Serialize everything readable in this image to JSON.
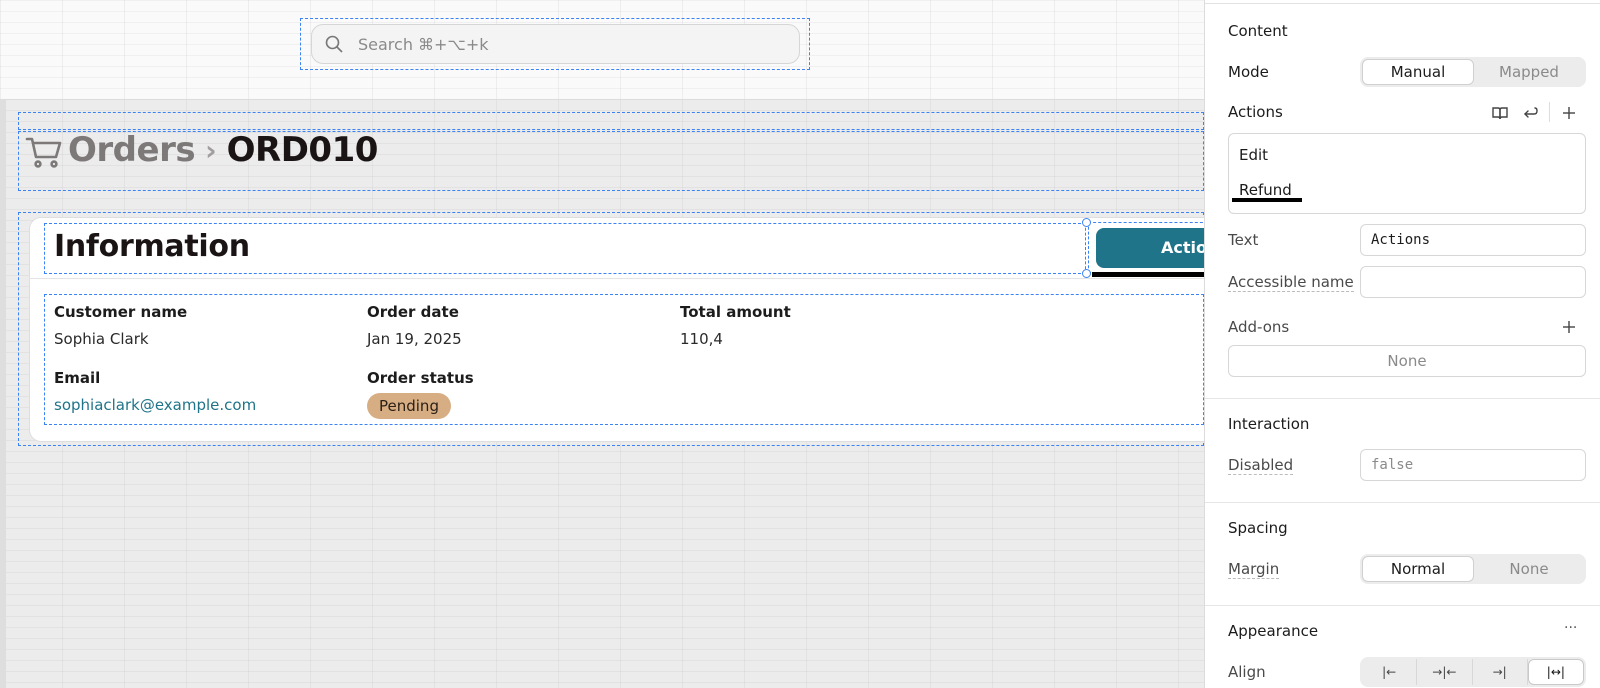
{
  "canvas": {
    "search": {
      "placeholder": "Search ⌘+⌥+k",
      "icon": "search-icon"
    },
    "breadcrumb": {
      "icon": "cart-icon",
      "parent": "Orders",
      "separator": "›",
      "current": "ORD010"
    },
    "info_card": {
      "title": "Information",
      "actions_button_label": "Actions",
      "fields": {
        "customer_name": {
          "label": "Customer name",
          "value": "Sophia Clark"
        },
        "order_date": {
          "label": "Order date",
          "value": "Jan 19, 2025"
        },
        "total_amount": {
          "label": "Total amount",
          "value": "110,4"
        },
        "email": {
          "label": "Email",
          "value": "sophiaclark@example.com"
        },
        "order_status": {
          "label": "Order status",
          "value": "Pending",
          "badge_color": "#d7ae83"
        }
      }
    }
  },
  "inspector": {
    "content_heading": "Content",
    "mode": {
      "label": "Mode",
      "options": [
        "Manual",
        "Mapped"
      ],
      "selected": "Manual"
    },
    "actions": {
      "label": "Actions",
      "icons": [
        "book-icon",
        "return-icon",
        "plus-icon"
      ],
      "items": [
        "Edit",
        "Refund"
      ]
    },
    "text": {
      "label": "Text",
      "value": "Actions"
    },
    "accessible_name": {
      "label": "Accessible name",
      "value": ""
    },
    "addons": {
      "label": "Add-ons",
      "value": "None"
    },
    "interaction_heading": "Interaction",
    "disabled": {
      "label": "Disabled",
      "value": "false"
    },
    "spacing_heading": "Spacing",
    "margin": {
      "label": "Margin",
      "options": [
        "Normal",
        "None"
      ],
      "selected": "Normal"
    },
    "appearance_heading": "Appearance",
    "appearance_more": "···",
    "align": {
      "label": "Align",
      "options": [
        "|←",
        "→|←",
        "→|",
        "|↔|"
      ],
      "selected": "|↔|"
    }
  },
  "colors": {
    "accent": "#1f7489",
    "selection": "#3b82f6",
    "badge": "#d7ae83"
  }
}
